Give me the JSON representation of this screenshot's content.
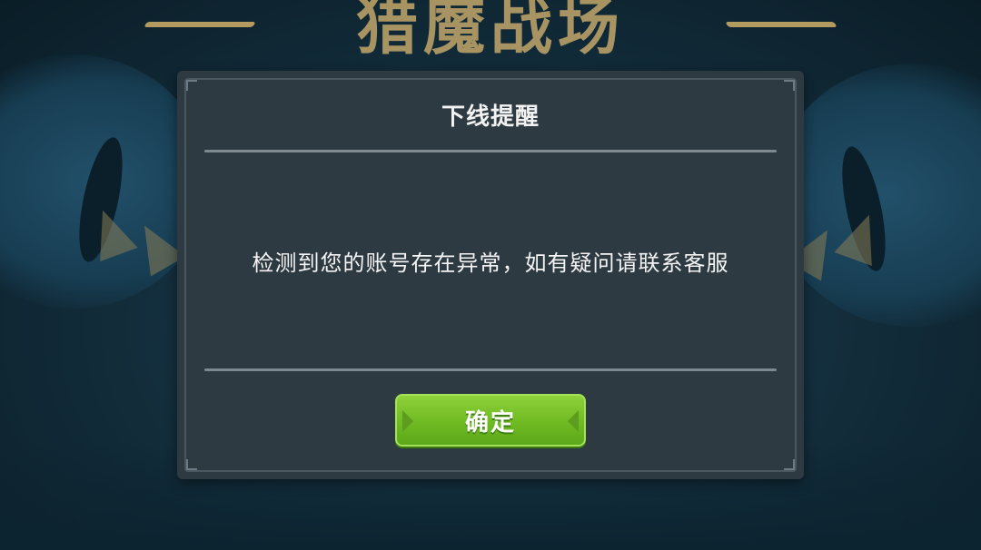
{
  "background": {
    "logo_text": "猎魔战场"
  },
  "dialog": {
    "title": "下线提醒",
    "message": "检测到您的账号存在异常，如有疑问请联系客服",
    "confirm_label": "确定"
  },
  "colors": {
    "dialog_bg": "#2e3a42",
    "button_green": "#6fba22",
    "text": "#f2f2f2"
  }
}
